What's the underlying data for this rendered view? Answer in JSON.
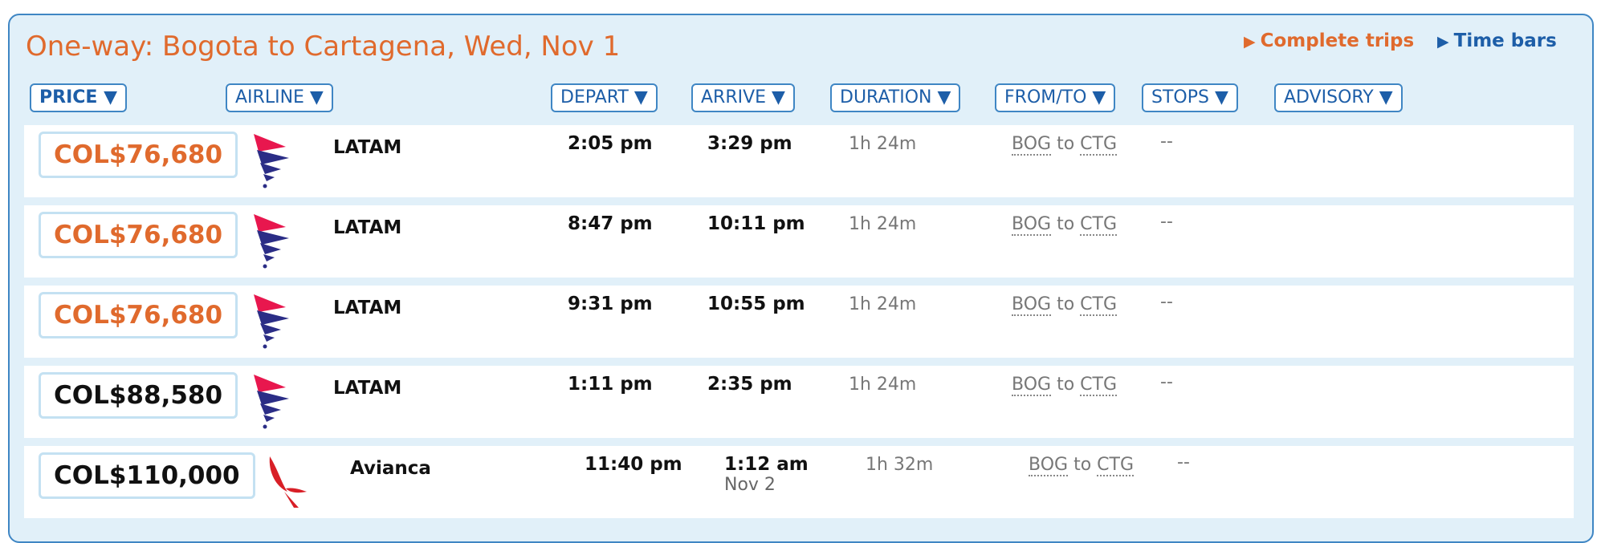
{
  "header": {
    "title": "One-way: Bogota to Cartagena, Wed, Nov 1",
    "complete_trips": "Complete trips",
    "time_bars": "Time bars",
    "tri_glyph": "▶"
  },
  "sort": {
    "price": "PRICE ▼",
    "airline": "AIRLINE ▼",
    "depart": "DEPART ▼",
    "arrive": "ARRIVE ▼",
    "duration": "DURATION ▼",
    "fromto": "FROM/TO ▼",
    "stops": "STOPS ▼",
    "advisory": "ADVISORY ▼"
  },
  "colors": {
    "accent_orange": "#e06a2d",
    "link_blue": "#1d5ea8",
    "panel_bg": "#e1f0f9",
    "border_blue": "#3f86c4"
  },
  "flights": [
    {
      "price": "COL$76,680",
      "airline": "LATAM",
      "depart": "2:05 pm",
      "arrive": "3:29 pm",
      "arrive_date": "",
      "duration": "1h 24m",
      "from": "BOG",
      "to_word": "to",
      "to": "CTG",
      "stops": "--",
      "logo": "latam-logo"
    },
    {
      "price": "COL$76,680",
      "airline": "LATAM",
      "depart": "8:47 pm",
      "arrive": "10:11 pm",
      "arrive_date": "",
      "duration": "1h 24m",
      "from": "BOG",
      "to_word": "to",
      "to": "CTG",
      "stops": "--",
      "logo": "latam-logo"
    },
    {
      "price": "COL$76,680",
      "airline": "LATAM",
      "depart": "9:31 pm",
      "arrive": "10:55 pm",
      "arrive_date": "",
      "duration": "1h 24m",
      "from": "BOG",
      "to_word": "to",
      "to": "CTG",
      "stops": "--",
      "logo": "latam-logo"
    },
    {
      "price": "COL$88,580",
      "airline": "LATAM",
      "depart": "1:11 pm",
      "arrive": "2:35 pm",
      "arrive_date": "",
      "duration": "1h 24m",
      "from": "BOG",
      "to_word": "to",
      "to": "CTG",
      "stops": "--",
      "logo": "latam-logo"
    },
    {
      "price": "COL$110,000",
      "airline": "Avianca",
      "depart": "11:40 pm",
      "arrive": "1:12 am",
      "arrive_date": "Nov 2",
      "duration": "1h 32m",
      "from": "BOG",
      "to_word": "to",
      "to": "CTG",
      "stops": "--",
      "logo": "avianca-logo"
    }
  ]
}
